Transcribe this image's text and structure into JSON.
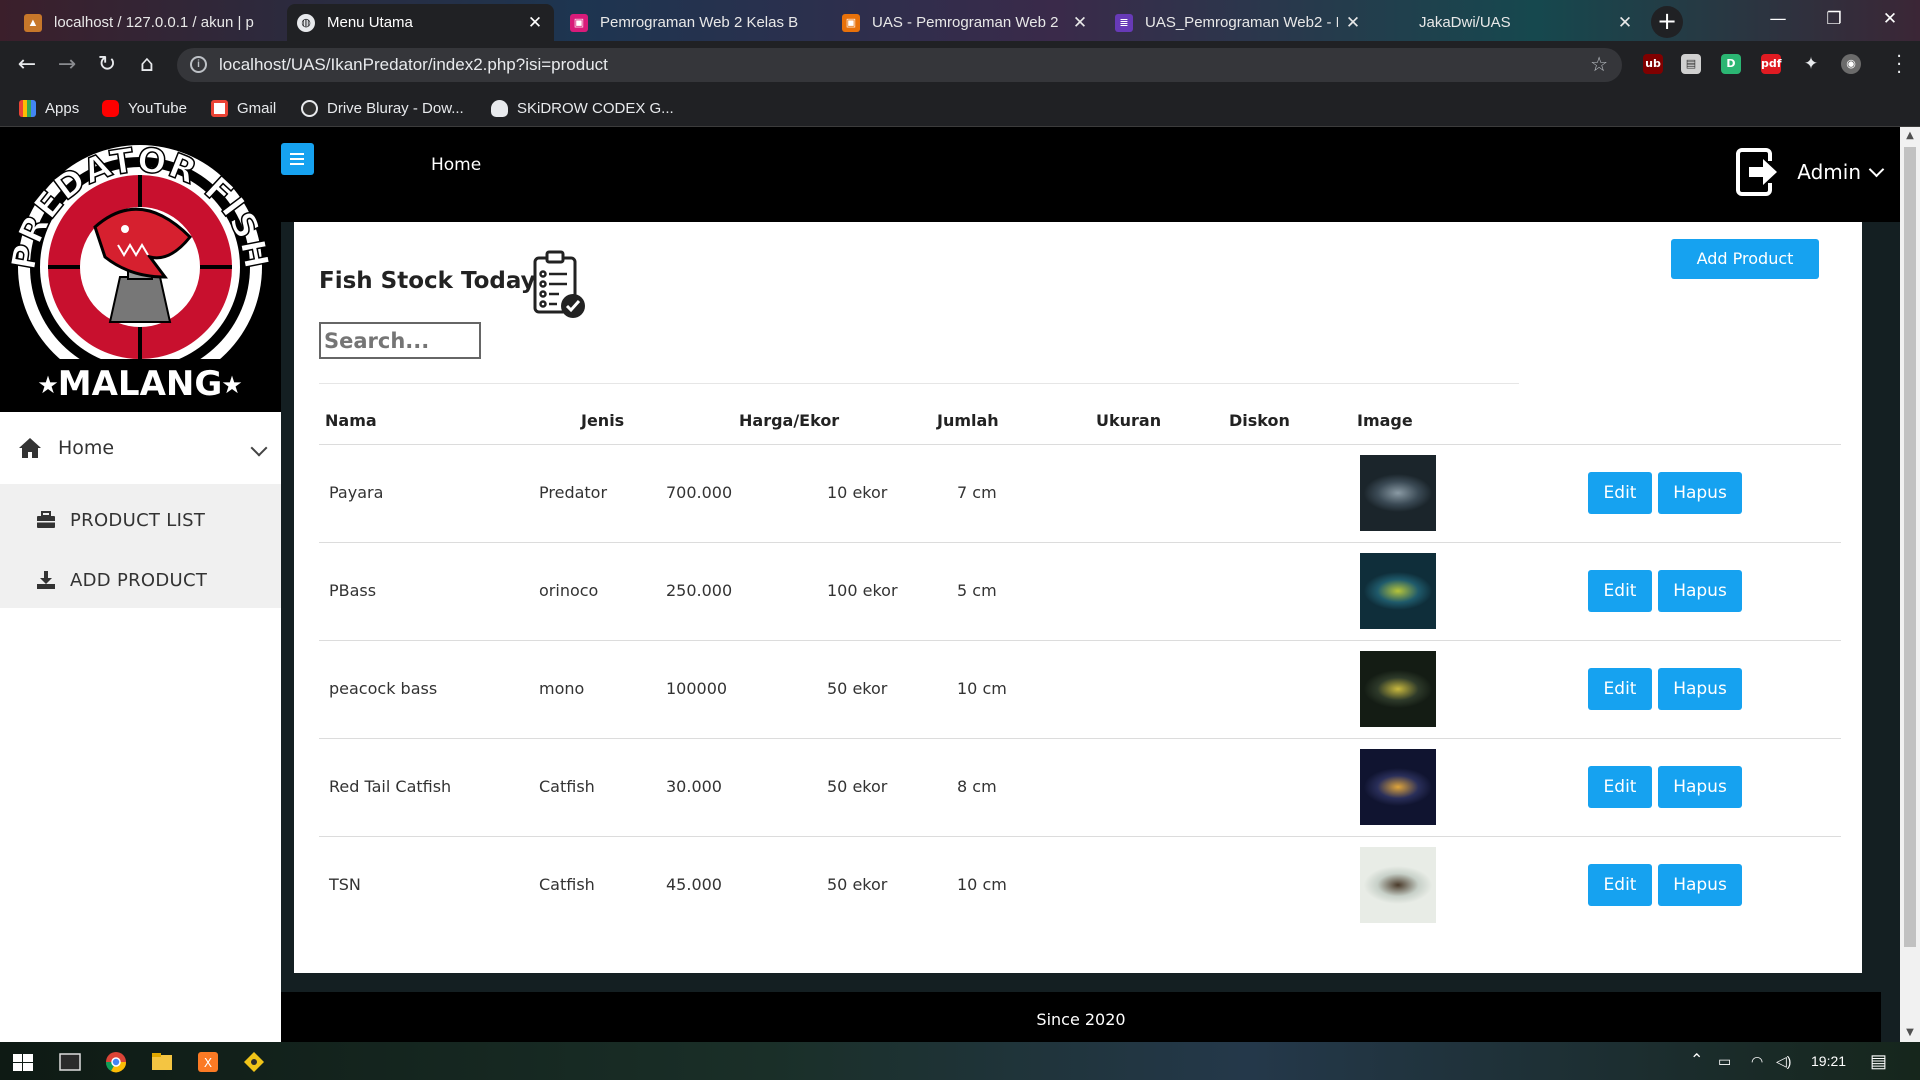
{
  "browser": {
    "tabs": [
      {
        "title": "localhost / 127.0.0.1 / akun | p",
        "active": false
      },
      {
        "title": "Menu Utama",
        "active": true
      },
      {
        "title": "Pemrograman Web 2 Kelas B",
        "active": false
      },
      {
        "title": "UAS - Pemrograman Web 2",
        "active": false
      },
      {
        "title": "UAS_Pemrograman Web2 - F",
        "active": false
      },
      {
        "title": "JakaDwi/UAS",
        "active": false
      }
    ],
    "url": "localhost/UAS/IkanPredator/index2.php?isi=product",
    "bookmarks": [
      {
        "label": "Apps"
      },
      {
        "label": "YouTube"
      },
      {
        "label": "Gmail"
      },
      {
        "label": "Drive Bluray - Dow..."
      },
      {
        "label": "SKiDROW CODEX G..."
      }
    ]
  },
  "logo": {
    "top_text": "PREDATOR FISH",
    "bottom_text": "MALANG"
  },
  "sidebar": {
    "home_label": "Home",
    "items": [
      {
        "label": "PRODUCT LIST",
        "icon": "briefcase-icon"
      },
      {
        "label": "ADD PRODUCT",
        "icon": "download-icon"
      }
    ]
  },
  "topnav": {
    "home_label": "Home",
    "user_label": "Admin"
  },
  "main": {
    "title": "Fish Stock Today",
    "search_placeholder": "Search...",
    "add_button": "Add Product",
    "columns": [
      "Nama",
      "Jenis",
      "Harga/Ekor",
      "Jumlah",
      "Ukuran",
      "Diskon",
      "Image"
    ],
    "rows": [
      {
        "nama": "Payara",
        "jenis": "Predator",
        "harga": "700.000",
        "jumlah": "10 ekor",
        "ukuran": "7 cm",
        "diskon": "",
        "img_colors": [
          "#3b4a55",
          "#8a9aa4",
          "#1b252b"
        ]
      },
      {
        "nama": "PBass",
        "jenis": "orinoco",
        "harga": "250.000",
        "jumlah": "100 ekor",
        "ukuran": "5 cm",
        "diskon": "",
        "img_colors": [
          "#1f5a6b",
          "#b6c43a",
          "#0f2e3a"
        ]
      },
      {
        "nama": "peacock bass",
        "jenis": "mono",
        "harga": "100000",
        "jumlah": "50 ekor",
        "ukuran": "10 cm",
        "diskon": "",
        "img_colors": [
          "#2e3a2a",
          "#c9b93e",
          "#141c14"
        ]
      },
      {
        "nama": "Red Tail Catfish",
        "jenis": "Catfish",
        "harga": "30.000",
        "jumlah": "50 ekor",
        "ukuran": "8 cm",
        "diskon": "",
        "img_colors": [
          "#2a2f5a",
          "#e0a53a",
          "#101430"
        ]
      },
      {
        "nama": "TSN",
        "jenis": "Catfish",
        "harga": "45.000",
        "jumlah": "50 ekor",
        "ukuran": "10 cm",
        "diskon": "",
        "img_colors": [
          "#c7d0c8",
          "#4a3a2a",
          "#e8ece6"
        ]
      }
    ],
    "edit_label": "Edit",
    "delete_label": "Hapus"
  },
  "footer": {
    "text": "Since 2020"
  },
  "taskbar": {
    "time": "19:21"
  },
  "colors": {
    "accent": "#16a2f0",
    "nav_bg": "#000000",
    "page_bg": "#141f22"
  }
}
